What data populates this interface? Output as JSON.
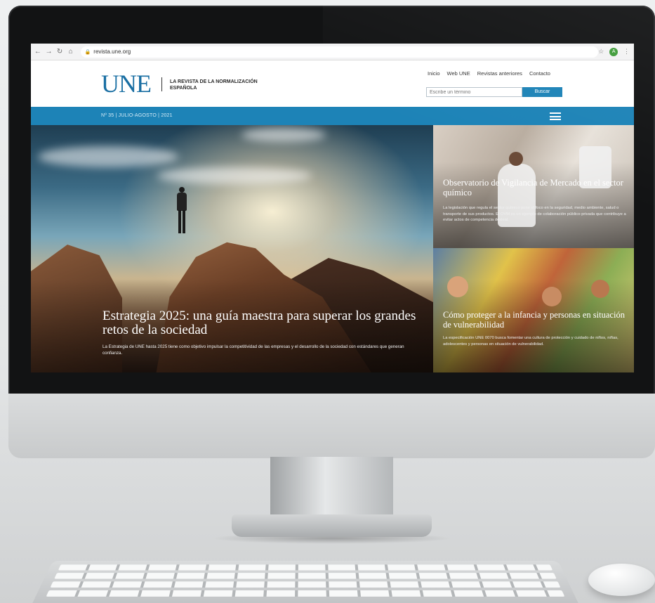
{
  "browser": {
    "url": "revista.une.org",
    "profile_initial": "A"
  },
  "site": {
    "logo": "UNE",
    "tagline": "LA REVISTA DE LA NORMALIZACIÓN ESPAÑOLA",
    "nav": [
      "Inicio",
      "Web UNE",
      "Revistas anteriores",
      "Contacto"
    ],
    "search_placeholder": "Escribe un término",
    "search_button": "Buscar",
    "issue": "Nº 35 | JULIO-AGOSTO | 2021",
    "accent_color": "#1d83b7"
  },
  "hero": {
    "title": "Estrategia 2025: una guía maestra para superar los grandes retos de la sociedad",
    "description": "La Estrategia de UNE hasta 2025 tiene como objetivo impulsar la competitividad de las empresas y el desarrollo de la sociedad con estándares que generan confianza."
  },
  "cards": [
    {
      "title": "Observatorio de Vigilancia de Mercado en el sector químico",
      "description": "La legislación que regula el sector químico pone el foco en la seguridad, medio ambiente, salud o transporte de sus productos. El OVM es un ejemplo de colaboración público-privada que contribuye a evitar actos de competencia desleal."
    },
    {
      "title": "Cómo proteger a la infancia y personas en situación de vulnerabilidad",
      "description": "La especificación UNE 0070 busca fomentar una cultura de protección y cuidado de niños, niñas, adolescentes y personas en situación de vulnerabilidad."
    }
  ]
}
